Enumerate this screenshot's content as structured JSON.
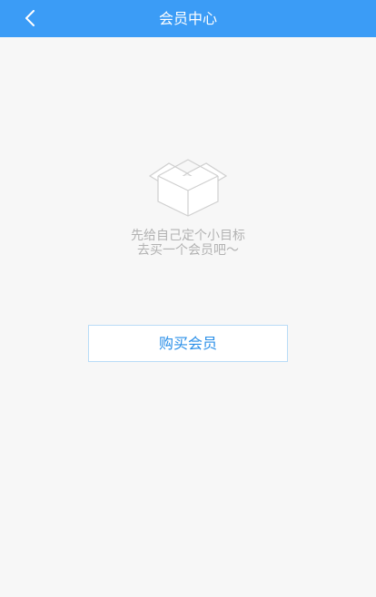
{
  "header": {
    "title": "会员中心",
    "back_icon": "chevron-left-icon"
  },
  "empty_state": {
    "icon": "empty-box-icon",
    "line1": "先给自己定个小目标",
    "line2": "去买一个会员吧～"
  },
  "actions": {
    "buy_label": "购买会员"
  },
  "colors": {
    "header_bg": "#3b9cf6",
    "page_bg": "#f7f7f7",
    "accent": "#2a8fe8",
    "muted_text": "#b2b2b2",
    "button_border": "#b9dcf7"
  }
}
